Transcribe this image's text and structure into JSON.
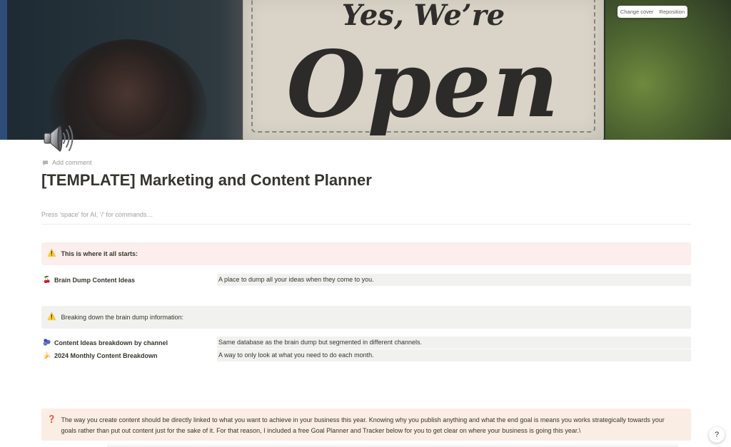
{
  "cover": {
    "sign_line_1": "Yes, We’re",
    "sign_line_2": "Open",
    "change_cover_label": "Change cover",
    "reposition_label": "Reposition"
  },
  "page": {
    "icon": "speaker-icon",
    "add_comment_label": "Add comment",
    "title": "[TEMPLATE] Marketing and Content Planner",
    "placeholder": "Press ‘space’ for AI, ‘/’ for commands…"
  },
  "callouts": {
    "start": {
      "icon": "⚠️",
      "text": "This is where it all starts:"
    },
    "breakdown": {
      "icon": "⚠️",
      "text": "Breaking down the brain dump information:"
    },
    "note": {
      "icon": "❓",
      "text": "The way you create content should be directly linked to what you want to achieve in your business this year. Knowing why you publish anything and what the end goal is means you works strategically towards your goals rather than put out content just for the sake of it. For that reason, I included a free Goal Planner and Tracker below for you to get clear on where your business is going this year.\\"
    }
  },
  "rows": [
    {
      "emoji": "🍒",
      "title": "Brain Dump Content Ideas",
      "description": "A place to dump all your ideas when they come to you."
    },
    {
      "emoji": "🫐",
      "title": "Content Ideas breakdown by channel",
      "description": "Same database as the brain dump but segmented in different channels."
    },
    {
      "emoji": "🍌",
      "title": "2024 Monthly Content Breakdown",
      "description": "A way to only look at what you need to do each month."
    }
  ],
  "help": {
    "label": "?"
  },
  "colors": {
    "callout_red": "#fbeeec",
    "callout_gray": "#f1f1ef",
    "callout_orange": "#faede3",
    "text": "#37352f"
  }
}
